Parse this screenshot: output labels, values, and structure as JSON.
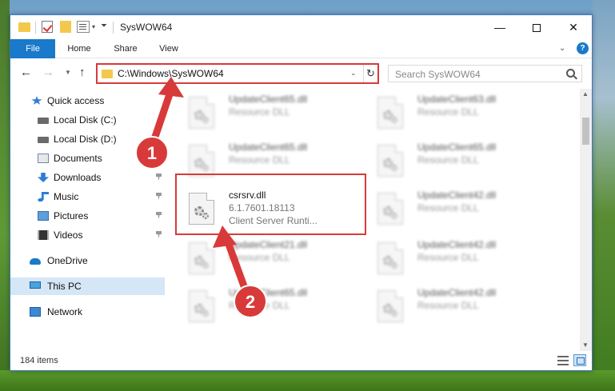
{
  "window": {
    "title": "SysWOW64",
    "controls": {
      "minimize": "—",
      "maximize": "",
      "close": "✕"
    }
  },
  "ribbon": {
    "tabs": [
      "File",
      "Home",
      "Share",
      "View"
    ],
    "help": "?"
  },
  "navigation": {
    "address": "C:\\Windows\\SysWOW64",
    "search_placeholder": "Search SysWOW64"
  },
  "sidebar": {
    "items": [
      {
        "label": "Quick access",
        "icon": "star-icon"
      },
      {
        "label": "Local Disk (C:)",
        "icon": "drive-icon"
      },
      {
        "label": "Local Disk (D:)",
        "icon": "drive-icon"
      },
      {
        "label": "Documents",
        "icon": "documents-icon",
        "pinned": true
      },
      {
        "label": "Downloads",
        "icon": "download-icon",
        "pinned": true
      },
      {
        "label": "Music",
        "icon": "music-icon",
        "pinned": true
      },
      {
        "label": "Pictures",
        "icon": "pictures-icon",
        "pinned": true
      },
      {
        "label": "Videos",
        "icon": "videos-icon",
        "pinned": true
      },
      {
        "label": "OneDrive",
        "icon": "cloud-icon"
      },
      {
        "label": "This PC",
        "icon": "computer-icon",
        "selected": true
      },
      {
        "label": "Network",
        "icon": "network-icon"
      }
    ]
  },
  "files": [
    {
      "name": "UpdateClient65.dll",
      "line2": "Resource DLL",
      "line3": "",
      "blurred": true
    },
    {
      "name": "UpdateClient63.dll",
      "line2": "Resource DLL",
      "line3": "",
      "blurred": true
    },
    {
      "name": "UpdateClient65.dll",
      "line2": "Resource DLL",
      "line3": "",
      "blurred": true
    },
    {
      "name": "UpdateClient65.dll",
      "line2": "Resource DLL",
      "line3": "",
      "blurred": true
    },
    {
      "name": "csrsrv.dll",
      "line2": "6.1.7601.18113",
      "line3": "Client Server Runti...",
      "blurred": false
    },
    {
      "name": "UpdateClient42.dll",
      "line2": "Resource DLL",
      "line3": "",
      "blurred": true
    },
    {
      "name": "UpdateClient21.dll",
      "line2": "Resource DLL",
      "line3": "",
      "blurred": true
    },
    {
      "name": "UpdateClient42.dll",
      "line2": "Resource DLL",
      "line3": "",
      "blurred": true
    },
    {
      "name": "UpdateClient65.dll",
      "line2": "Resource DLL",
      "line3": "",
      "blurred": true
    },
    {
      "name": "UpdateClient42.dll",
      "line2": "Resource DLL",
      "line3": "",
      "blurred": true
    }
  ],
  "status": {
    "item_count": "184 items"
  },
  "annotations": {
    "badge1": "1",
    "badge2": "2",
    "color": "#d83a3a"
  }
}
